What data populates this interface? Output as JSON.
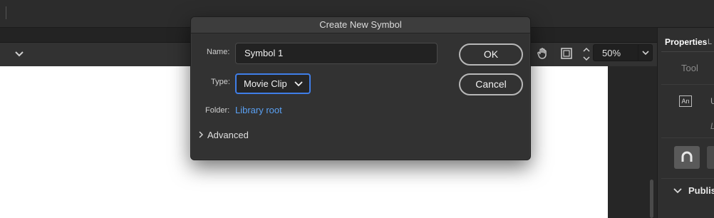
{
  "dialog": {
    "title": "Create New Symbol",
    "name_label": "Name:",
    "name_value": "Symbol 1",
    "type_label": "Type:",
    "type_value": "Movie Clip",
    "folder_label": "Folder:",
    "folder_value": "Library root",
    "advanced_label": "Advanced",
    "ok_label": "OK",
    "cancel_label": "Cancel"
  },
  "toolbar": {
    "zoom_value": "50%"
  },
  "right_panel": {
    "tab_label": "Properties",
    "tab2_label": "L",
    "tool_label": "Tool",
    "text_tool_abbrev": "An",
    "text_u": "U",
    "text_l": "L",
    "publish_label": "Publis"
  },
  "colors": {
    "accent": "#3f7ee8",
    "link": "#5aa0f2",
    "dialog_bg": "#323232",
    "stage": "#ffffff"
  },
  "icons": [
    "chevron-down-icon",
    "hand-tool-icon",
    "clip-content-icon",
    "stepper-icon",
    "magnet-icon",
    "chevron-right-icon"
  ]
}
